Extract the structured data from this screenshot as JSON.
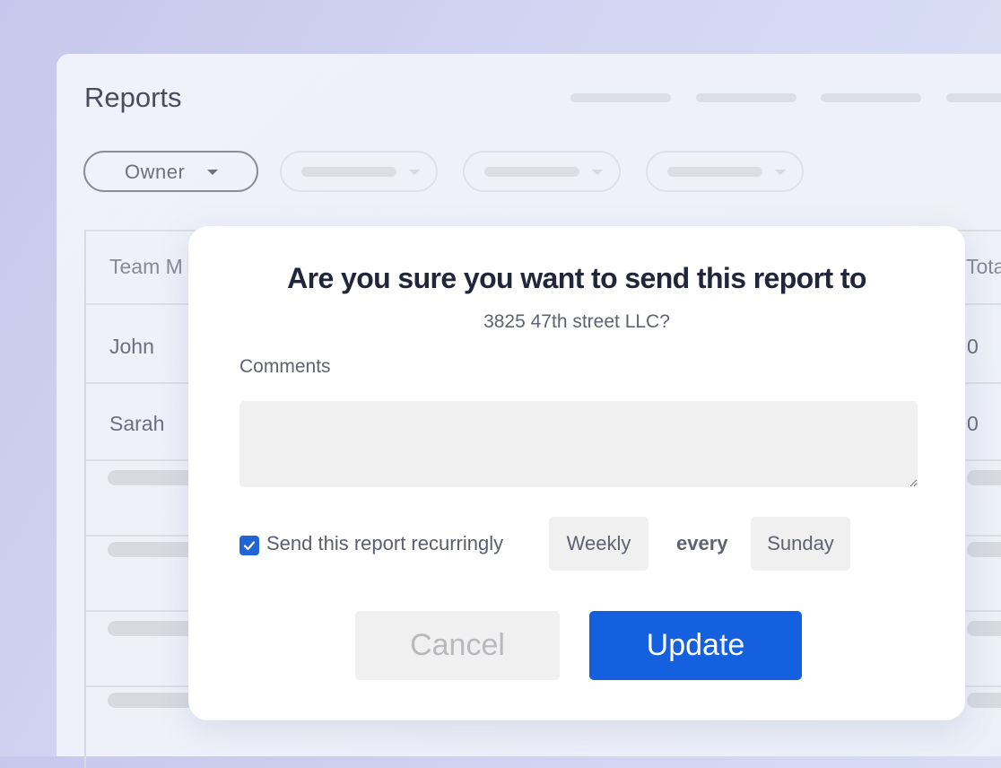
{
  "page": {
    "title": "Reports"
  },
  "filters": {
    "owner_label": "Owner"
  },
  "table": {
    "header_first": "Team M",
    "header_last": "Tota",
    "rows": [
      {
        "name": "John",
        "total": "0"
      },
      {
        "name": "Sarah",
        "total": "0"
      }
    ]
  },
  "modal": {
    "title": "Are you sure you want to send this report to",
    "subtitle": "3825 47th street LLC?",
    "comments_label": "Comments",
    "comments_value": "",
    "recurring_label": "Send this report recurringly",
    "recurring_checked": true,
    "frequency": "Weekly",
    "every_label": "every",
    "day": "Sunday",
    "cancel_label": "Cancel",
    "update_label": "Update"
  },
  "colors": {
    "primary": "#1560de",
    "checkbox": "#1f65d6",
    "title_text": "#22263a"
  }
}
